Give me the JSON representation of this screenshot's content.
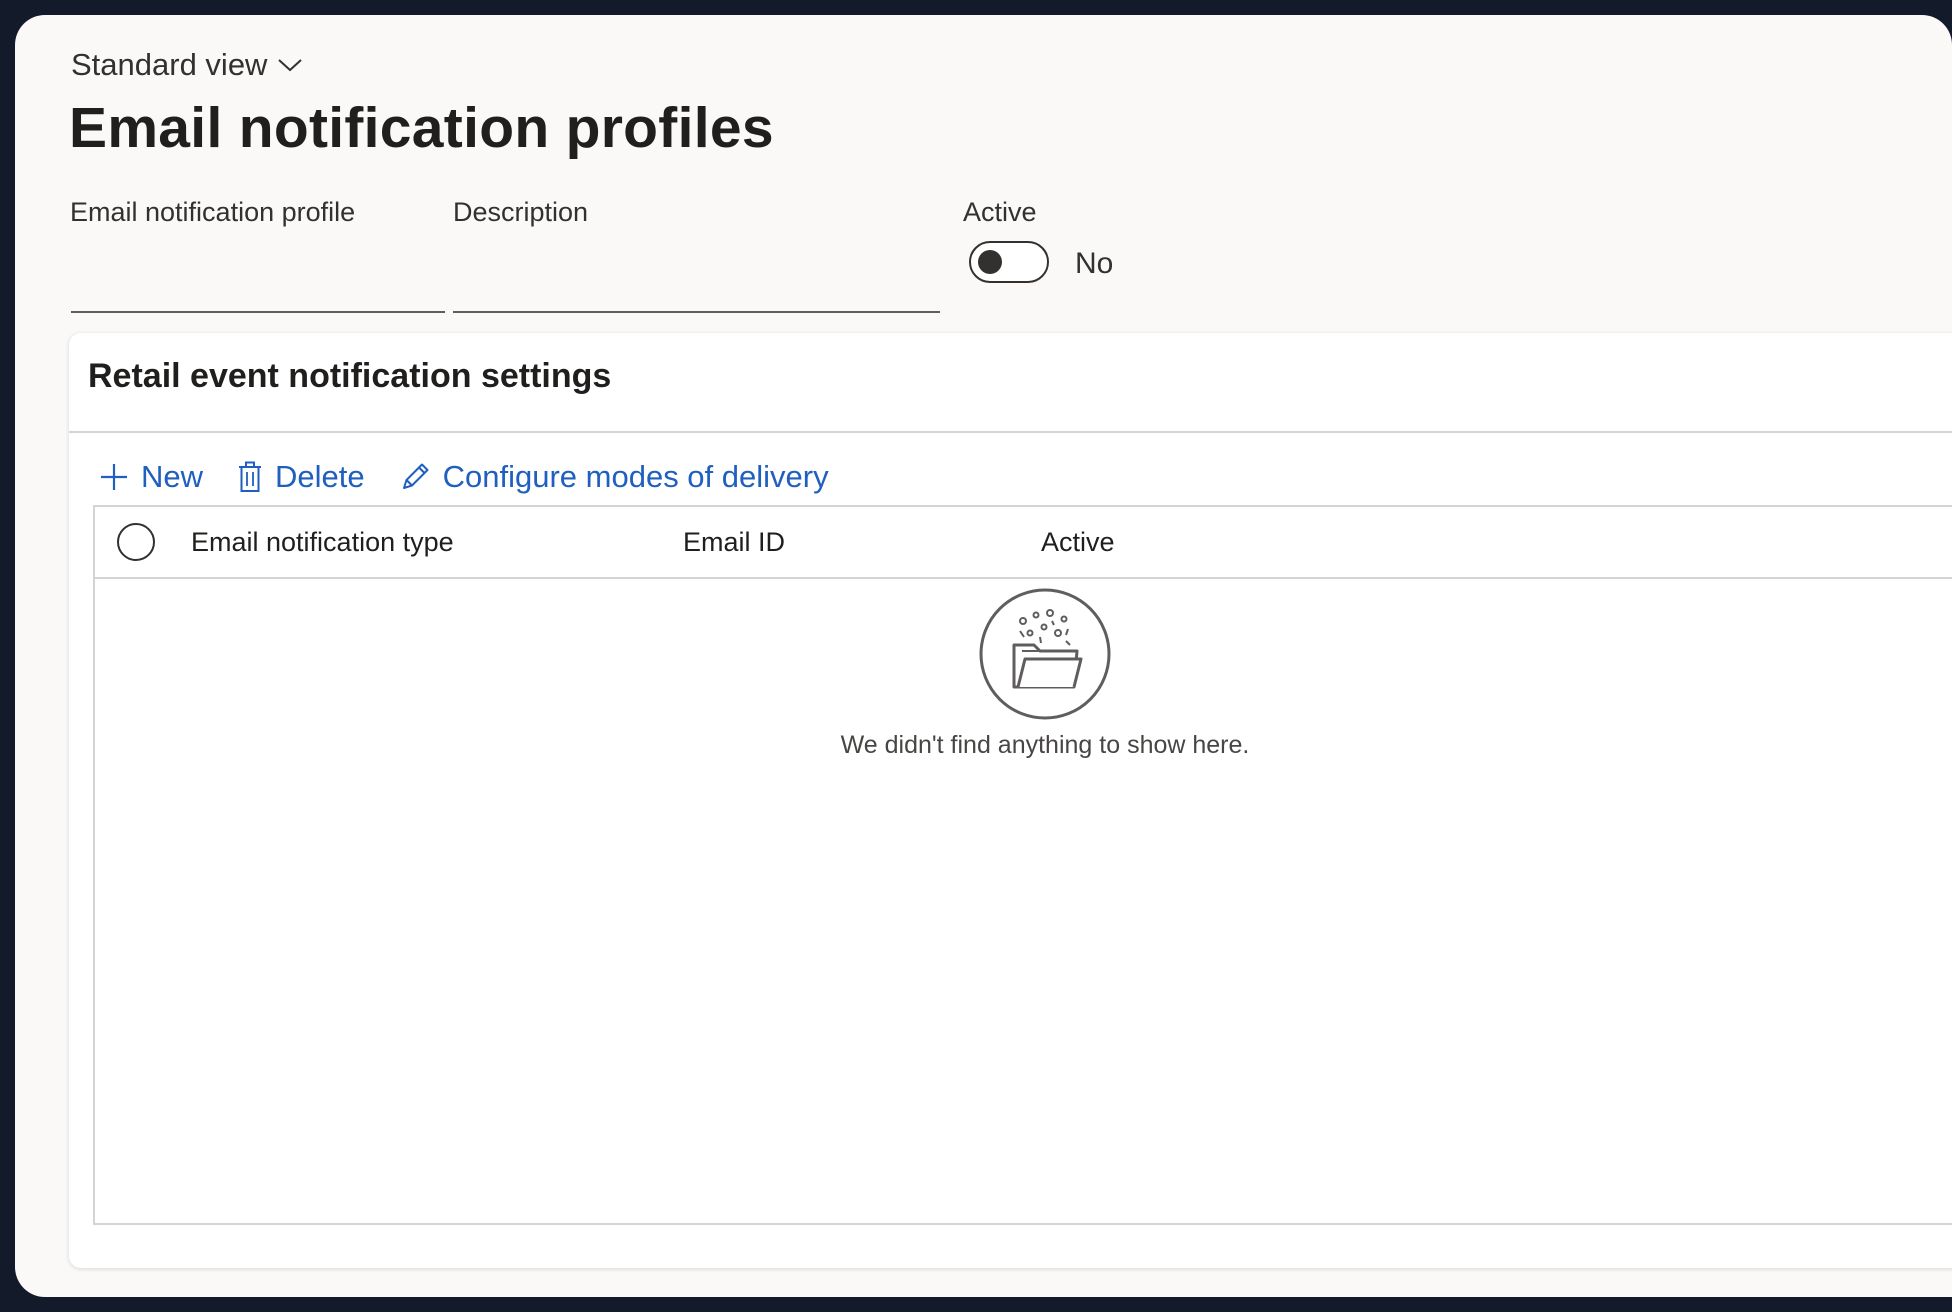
{
  "header": {
    "view_selector": "Standard view",
    "title": "Email notification profiles"
  },
  "form": {
    "profile_label": "Email notification profile",
    "profile_value": "",
    "description_label": "Description",
    "description_value": "",
    "active_label": "Active",
    "active_value": "No",
    "active_on": false
  },
  "panel": {
    "title": "Retail event notification settings",
    "toolbar": {
      "new_label": "New",
      "delete_label": "Delete",
      "configure_label": "Configure modes of delivery"
    },
    "grid": {
      "columns": [
        "Email notification type",
        "Email ID",
        "Active"
      ],
      "rows": [],
      "empty_message": "We didn't find anything to show here."
    }
  },
  "colors": {
    "accent": "#1f5fbf",
    "text": "#201f1e",
    "border": "#d6d4d2",
    "background": "#faf9f8"
  }
}
